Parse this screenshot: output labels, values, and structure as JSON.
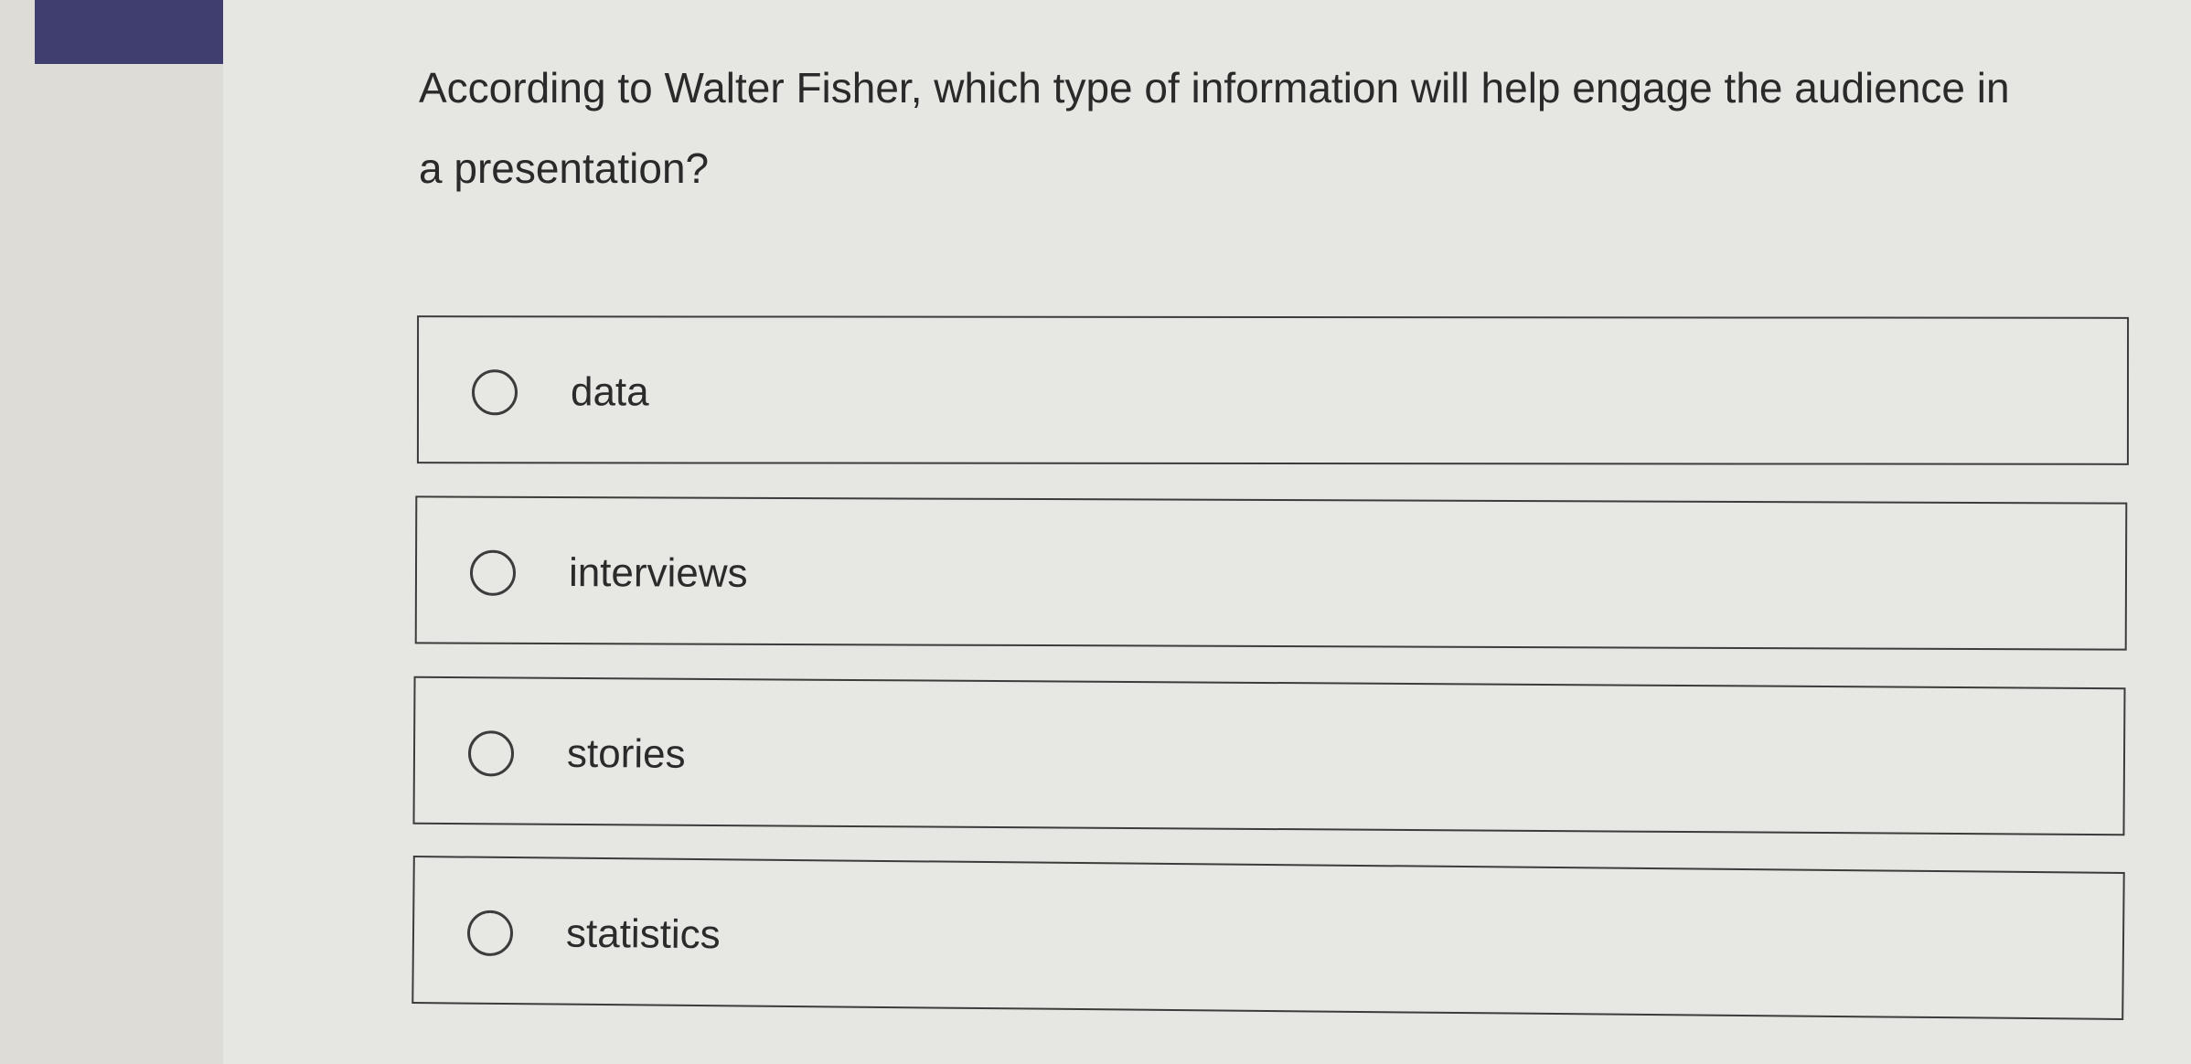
{
  "question": {
    "text": "According to Walter Fisher, which type of information will help engage the audience in a presentation?"
  },
  "options": [
    {
      "label": "data",
      "selected": false
    },
    {
      "label": "interviews",
      "selected": false
    },
    {
      "label": "stories",
      "selected": false
    },
    {
      "label": "statistics",
      "selected": false
    }
  ],
  "colors": {
    "nav_block": "#3f3e6e",
    "background": "#e6e6e2",
    "border": "#3c3c3c"
  }
}
